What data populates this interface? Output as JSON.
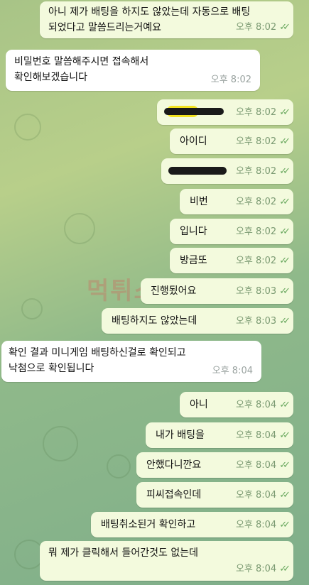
{
  "watermark": "먹튀스팟9",
  "messages": [
    {
      "side": "out",
      "text": "아니 제가 배팅을 하지도 않았는데 자동으로 배팅\n되었다고 말씀드리는거예요",
      "time": "오후 8:02"
    },
    {
      "side": "in",
      "text": "비밀번호 말씀해주시면 접속해서\n확인해보겠습니다",
      "time": "오후 8:02"
    },
    {
      "side": "out",
      "text": "",
      "time": "오후 8:02",
      "redacted": "yellow"
    },
    {
      "side": "out",
      "text": "아이디",
      "time": "오후 8:02"
    },
    {
      "side": "out",
      "text": "",
      "time": "오후 8:02",
      "redacted": "black"
    },
    {
      "side": "out",
      "text": "비번",
      "time": "오후 8:02"
    },
    {
      "side": "out",
      "text": "입니다",
      "time": "오후 8:02"
    },
    {
      "side": "out",
      "text": "방금또",
      "time": "오후 8:02"
    },
    {
      "side": "out",
      "text": "진행됬어요",
      "time": "오후 8:03"
    },
    {
      "side": "out",
      "text": "배팅하지도 않았는데",
      "time": "오후 8:03"
    },
    {
      "side": "in",
      "text": "확인 결과 미니게임 배팅하신걸로 확인되고\n낙첨으로 확인됩니다",
      "time": "오후 8:04"
    },
    {
      "side": "out",
      "text": "아니",
      "time": "오후 8:04"
    },
    {
      "side": "out",
      "text": "내가 배팅을",
      "time": "오후 8:04"
    },
    {
      "side": "out",
      "text": "안했다니깐요",
      "time": "오후 8:04"
    },
    {
      "side": "out",
      "text": "피씨접속인데",
      "time": "오후 8:04"
    },
    {
      "side": "out",
      "text": "배팅취소된거 확인하고",
      "time": "오후 8:04"
    },
    {
      "side": "out",
      "text": "뭐 제가 클릭해서 들어간것도 없는데",
      "time": "오후 8:04"
    }
  ],
  "read_receipt_icon": "double-check-icon"
}
